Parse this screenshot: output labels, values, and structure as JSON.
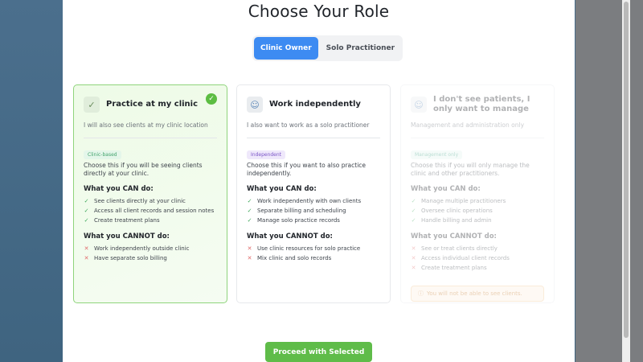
{
  "page": {
    "title": "Choose Your Role"
  },
  "toggle": {
    "options": [
      {
        "label": "Clinic Owner",
        "active": true
      },
      {
        "label": "Solo Practitioner",
        "active": false
      }
    ]
  },
  "cards": [
    {
      "title": "Practice at my clinic",
      "description": "I will also see clients at my clinic location",
      "tag": "Clinic-based",
      "choose": "Choose this if you will be seeing clients directly at your clinic.",
      "can_title": "What you CAN do:",
      "can": [
        "See clients directly at your clinic",
        "Access all client records and session notes",
        "Create treatment plans"
      ],
      "cannot_title": "What you CANNOT do:",
      "cannot": [
        "Work independently outside clinic",
        "Have separate solo billing"
      ],
      "icon": "check-icon"
    },
    {
      "title": "Work independently",
      "description": "I also want to work as a solo practitioner",
      "tag": "Independent",
      "choose": "Choose this if you want to also practice independently.",
      "can_title": "What you CAN do:",
      "can": [
        "Work independently with own clients",
        "Separate billing and scheduling",
        "Manage solo practice records"
      ],
      "cannot_title": "What you CANNOT do:",
      "cannot": [
        "Use clinic resources for solo practice",
        "Mix clinic and solo records"
      ],
      "icon": "user-icon"
    },
    {
      "title": "I don't see patients, I only want to manage",
      "description": "Management and administration only",
      "tag": "Management only",
      "choose": "Choose this if you will only manage the clinic and other practitioners.",
      "can_title": "What you CAN do:",
      "can": [
        "Manage multiple practitioners",
        "Oversee clinic operations",
        "Handle billing and admin"
      ],
      "cannot_title": "What you CANNOT do:",
      "cannot": [
        "See or treat clients directly",
        "Access individual client records",
        "Create treatment plans"
      ],
      "warning": "You will not be able to see clients.",
      "icon": "users-icon"
    }
  ],
  "actions": {
    "proceed_label": "Proceed with Selected"
  },
  "colors": {
    "accent": "#3d8bf2",
    "success": "#5fbc49",
    "warning": "#c57a2c"
  }
}
